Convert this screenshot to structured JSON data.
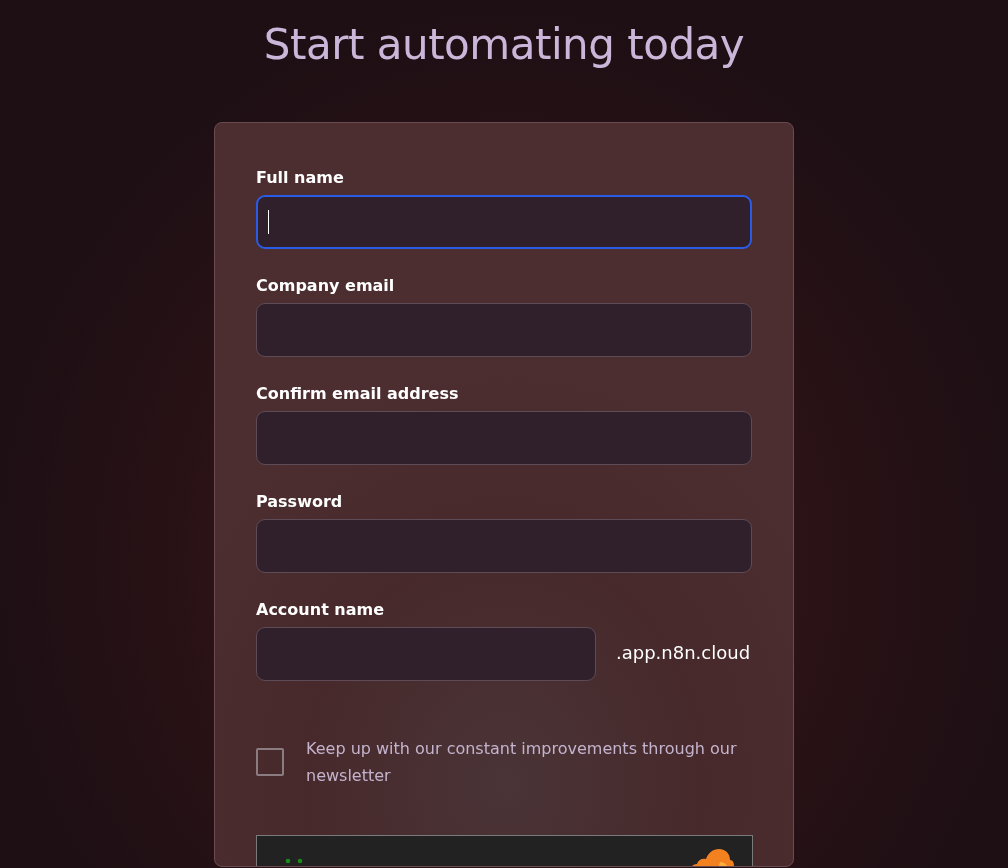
{
  "heading": "Start automating today",
  "form": {
    "fields": [
      {
        "kind": "text",
        "label": "Full name",
        "focused": true
      },
      {
        "kind": "text",
        "label": "Company email",
        "focused": false
      },
      {
        "kind": "text",
        "label": "Confirm email address",
        "focused": false
      },
      {
        "kind": "text",
        "label": "Password",
        "focused": false
      },
      {
        "kind": "suffix",
        "label": "Account name",
        "focused": false,
        "suffix": ".app.n8n.cloud"
      }
    ],
    "newsletter": {
      "label": "Keep up with our constant improvements through our newsletter",
      "checked": false
    }
  }
}
